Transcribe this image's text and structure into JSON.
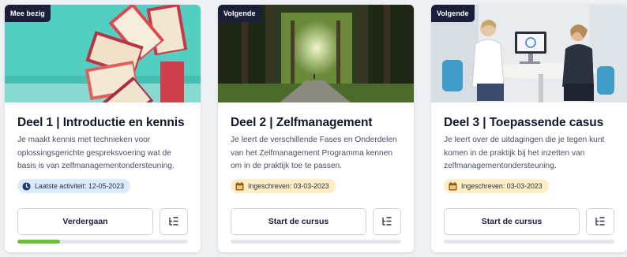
{
  "cards": [
    {
      "badge": "Mee bezig",
      "title": "Deel 1 | Introductie en kennis",
      "description": "Je maakt kennis met technieken voor oplossingsgerichte gespreksvoering wat de basis is van zelfmanagementondersteuning.",
      "chip": {
        "text": "Laatste activiteit: 12-05-2023",
        "icon": "clock-icon",
        "color": "#dcebfb"
      },
      "button": "Verdergaan",
      "progress": 0.25,
      "progress_color": "#6fbf3e"
    },
    {
      "badge": "Volgende",
      "title": "Deel 2 | Zelfmanagement",
      "description": "Je leert de verschillende Fases en Onderdelen van het Zelfmanagement Programma kennen om in de praktijk toe te passen.",
      "chip": {
        "text": "Ingeschreven: 03-03-2023",
        "icon": "calendar-icon",
        "color": "#fbedc6"
      },
      "button": "Start de cursus",
      "progress": 0
    },
    {
      "badge": "Volgende",
      "title": "Deel 3 | Toepassende casus",
      "description": "Je leert over de uitdagingen die je tegen kunt komen in de praktijk bij het inzetten van zelfmanagementondersteuning.",
      "chip": {
        "text": "Ingeschreven: 03-03-2023",
        "icon": "calendar-icon",
        "color": "#fbedc6"
      },
      "button": "Start de cursus",
      "progress": 0
    }
  ]
}
